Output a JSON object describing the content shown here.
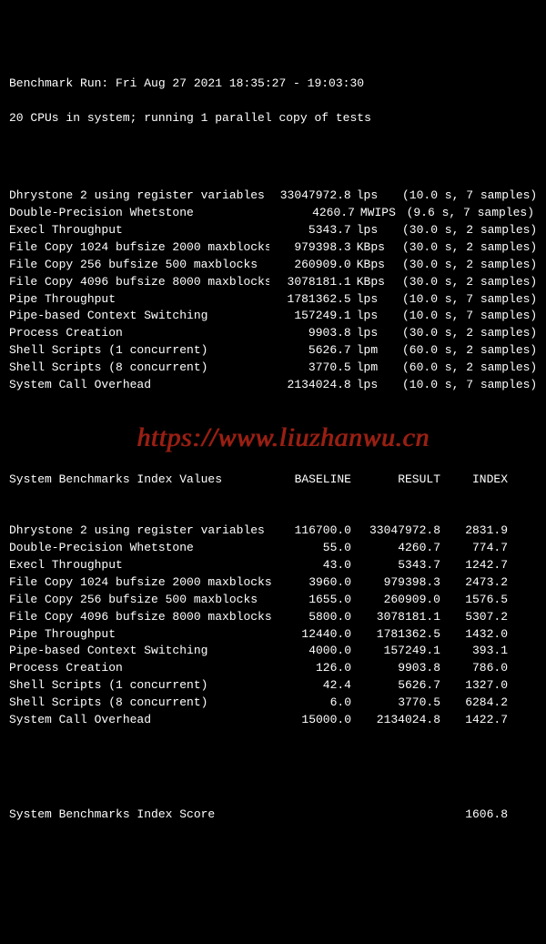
{
  "header": {
    "line1": "Benchmark Run: Fri Aug 27 2021 18:35:27 - 19:03:30",
    "line2": "20 CPUs in system; running 1 parallel copy of tests"
  },
  "results": [
    {
      "name": "Dhrystone 2 using register variables",
      "value": "33047972.8",
      "unit": "lps",
      "timing": "(10.0 s, 7 samples)"
    },
    {
      "name": "Double-Precision Whetstone",
      "value": "4260.7",
      "unit": "MWIPS",
      "timing": "(9.6 s, 7 samples)"
    },
    {
      "name": "Execl Throughput",
      "value": "5343.7",
      "unit": "lps",
      "timing": "(30.0 s, 2 samples)"
    },
    {
      "name": "File Copy 1024 bufsize 2000 maxblocks",
      "value": "979398.3",
      "unit": "KBps",
      "timing": "(30.0 s, 2 samples)"
    },
    {
      "name": "File Copy 256 bufsize 500 maxblocks",
      "value": "260909.0",
      "unit": "KBps",
      "timing": "(30.0 s, 2 samples)"
    },
    {
      "name": "File Copy 4096 bufsize 8000 maxblocks",
      "value": "3078181.1",
      "unit": "KBps",
      "timing": "(30.0 s, 2 samples)"
    },
    {
      "name": "Pipe Throughput",
      "value": "1781362.5",
      "unit": "lps",
      "timing": "(10.0 s, 7 samples)"
    },
    {
      "name": "Pipe-based Context Switching",
      "value": "157249.1",
      "unit": "lps",
      "timing": "(10.0 s, 7 samples)"
    },
    {
      "name": "Process Creation",
      "value": "9903.8",
      "unit": "lps",
      "timing": "(30.0 s, 2 samples)"
    },
    {
      "name": "Shell Scripts (1 concurrent)",
      "value": "5626.7",
      "unit": "lpm",
      "timing": "(60.0 s, 2 samples)"
    },
    {
      "name": "Shell Scripts (8 concurrent)",
      "value": "3770.5",
      "unit": "lpm",
      "timing": "(60.0 s, 2 samples)"
    },
    {
      "name": "System Call Overhead",
      "value": "2134024.8",
      "unit": "lps",
      "timing": "(10.0 s, 7 samples)"
    }
  ],
  "index_header": {
    "title": "System Benchmarks Index Values",
    "baseline": "BASELINE",
    "result": "RESULT",
    "index": "INDEX"
  },
  "index_rows": [
    {
      "name": "Dhrystone 2 using register variables",
      "baseline": "116700.0",
      "result": "33047972.8",
      "index": "2831.9"
    },
    {
      "name": "Double-Precision Whetstone",
      "baseline": "55.0",
      "result": "4260.7",
      "index": "774.7"
    },
    {
      "name": "Execl Throughput",
      "baseline": "43.0",
      "result": "5343.7",
      "index": "1242.7"
    },
    {
      "name": "File Copy 1024 bufsize 2000 maxblocks",
      "baseline": "3960.0",
      "result": "979398.3",
      "index": "2473.2"
    },
    {
      "name": "File Copy 256 bufsize 500 maxblocks",
      "baseline": "1655.0",
      "result": "260909.0",
      "index": "1576.5"
    },
    {
      "name": "File Copy 4096 bufsize 8000 maxblocks",
      "baseline": "5800.0",
      "result": "3078181.1",
      "index": "5307.2"
    },
    {
      "name": "Pipe Throughput",
      "baseline": "12440.0",
      "result": "1781362.5",
      "index": "1432.0"
    },
    {
      "name": "Pipe-based Context Switching",
      "baseline": "4000.0",
      "result": "157249.1",
      "index": "393.1"
    },
    {
      "name": "Process Creation",
      "baseline": "126.0",
      "result": "9903.8",
      "index": "786.0"
    },
    {
      "name": "Shell Scripts (1 concurrent)",
      "baseline": "42.4",
      "result": "5626.7",
      "index": "1327.0"
    },
    {
      "name": "Shell Scripts (8 concurrent)",
      "baseline": "6.0",
      "result": "3770.5",
      "index": "6284.2"
    },
    {
      "name": "System Call Overhead",
      "baseline": "15000.0",
      "result": "2134024.8",
      "index": "1422.7"
    }
  ],
  "score": {
    "label": "System Benchmarks Index Score",
    "value": "1606.8"
  },
  "watermark": "https://www.liuzhanwu.cn"
}
